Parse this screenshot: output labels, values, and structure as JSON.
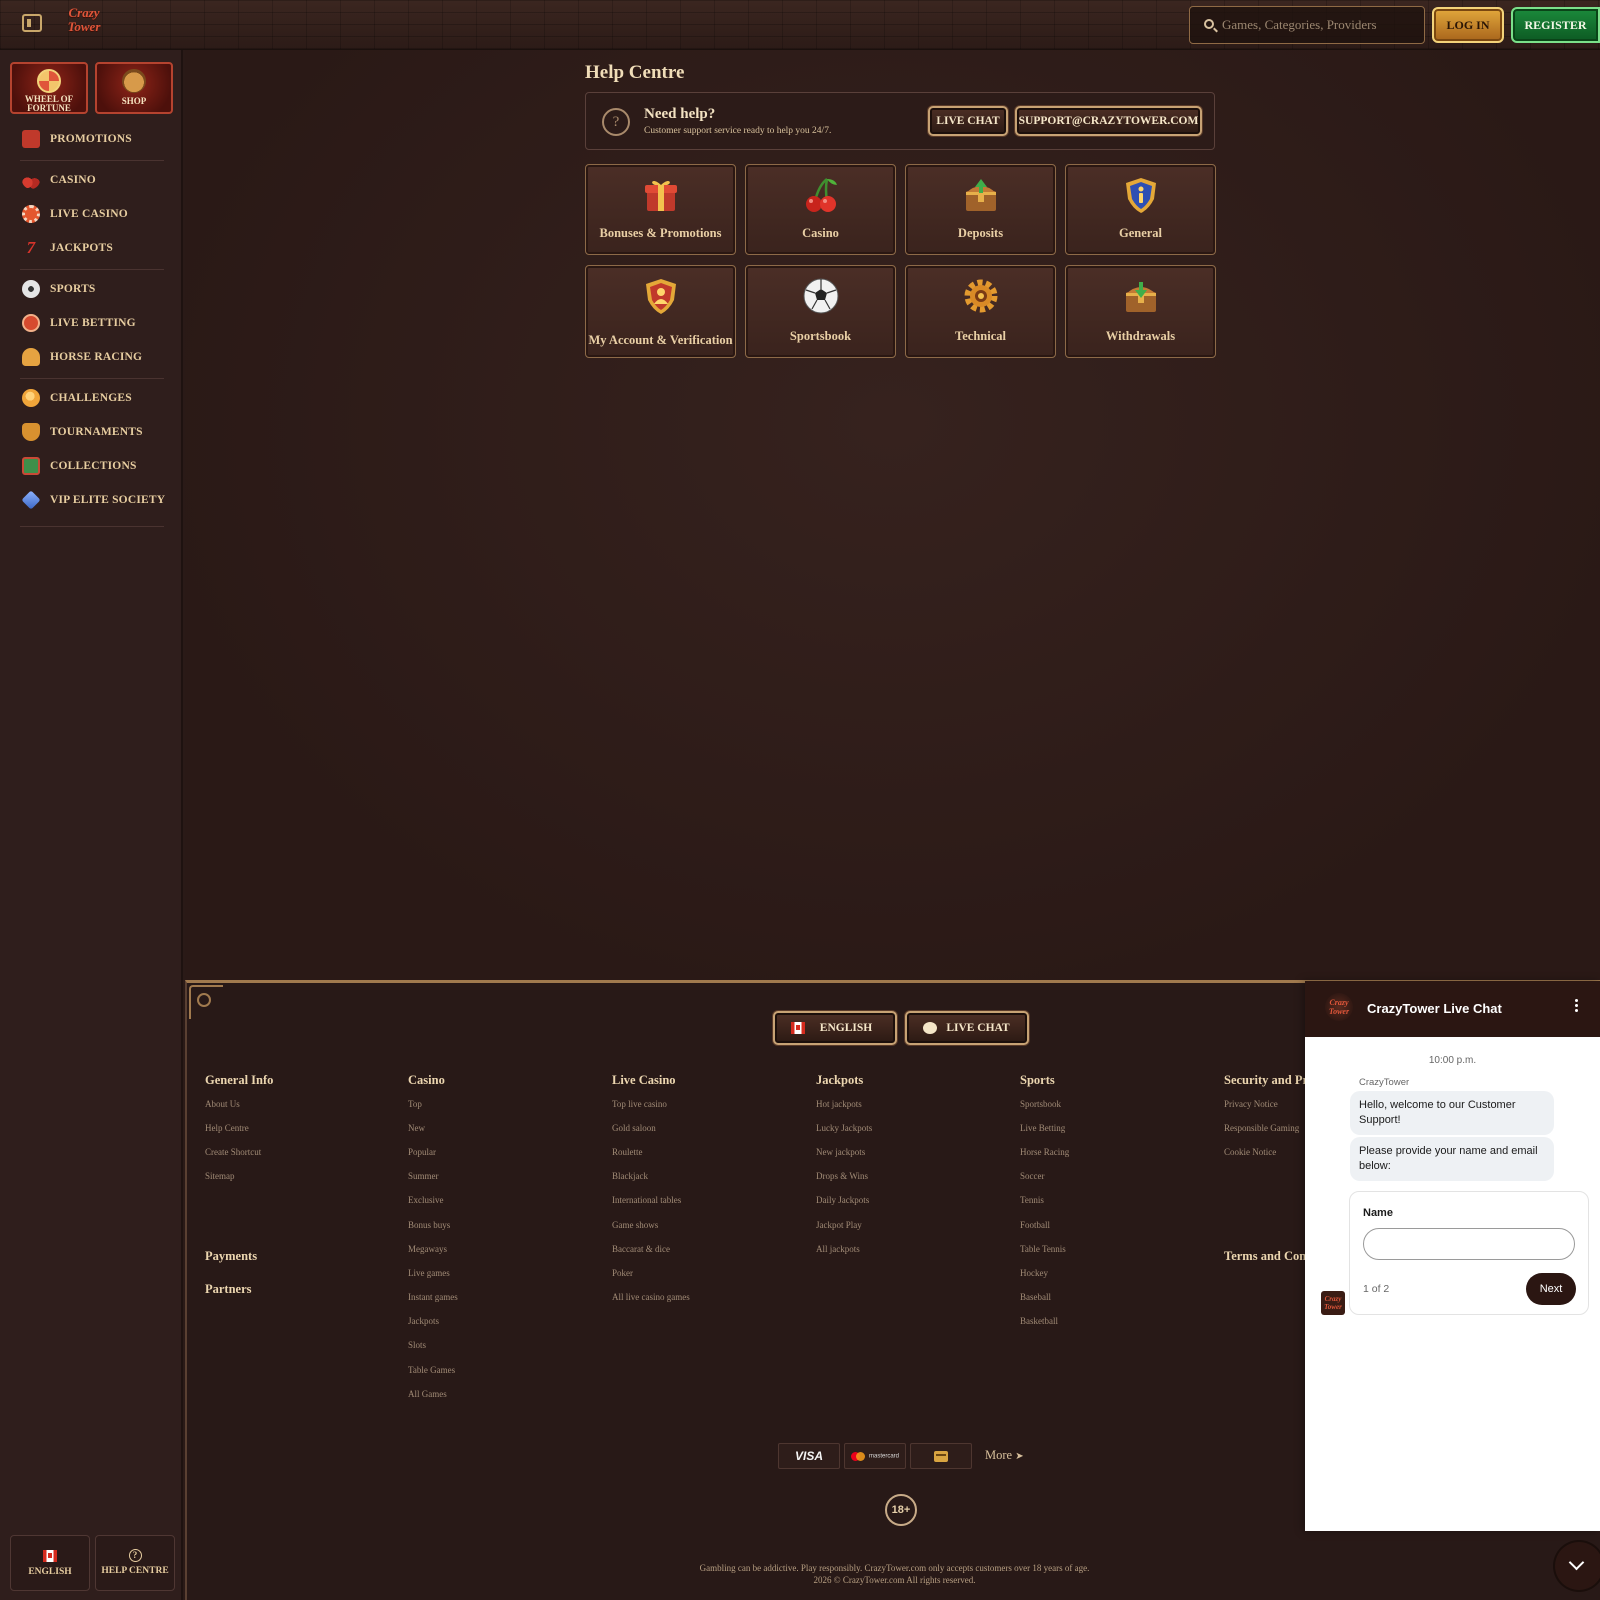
{
  "header": {
    "logo_text": "Crazy Tower",
    "search_placeholder": "Games, Categories, Providers",
    "login_label": "LOG IN",
    "register_label": "REGISTER"
  },
  "sidebar": {
    "tiles": [
      {
        "label": "WHEEL OF FORTUNE",
        "icon": "wheel-icon"
      },
      {
        "label": "SHOP",
        "icon": "basket-icon"
      }
    ],
    "items": [
      {
        "label": "PROMOTIONS",
        "icon": "gift-icon",
        "color": "#c0392b"
      },
      {
        "label": "CASINO",
        "icon": "cherry-icon",
        "color": "#d63b2f"
      },
      {
        "label": "LIVE CASINO",
        "icon": "chip-icon",
        "color": "#e4572e"
      },
      {
        "label": "JACKPOTS",
        "icon": "seven-icon",
        "color": "#d9342b"
      },
      {
        "label": "SPORTS",
        "icon": "soccer-ball-icon",
        "color": "#dddddd"
      },
      {
        "label": "LIVE BETTING",
        "icon": "live-icon",
        "color": "#d64a2f"
      },
      {
        "label": "HORSE RACING",
        "icon": "horse-icon",
        "color": "#e6a341"
      },
      {
        "label": "CHALLENGES",
        "icon": "medal-icon",
        "color": "#f0a53a"
      },
      {
        "label": "TOURNAMENTS",
        "icon": "trophy-icon",
        "color": "#d8912f"
      },
      {
        "label": "COLLECTIONS",
        "icon": "cards-icon",
        "color": "#3f8f4a"
      },
      {
        "label": "VIP ELITE SOCIETY",
        "icon": "diamond-icon",
        "color": "#4a7fd6"
      }
    ],
    "language_label": "ENGLISH",
    "help_label": "HELP CENTRE"
  },
  "main": {
    "title": "Help Centre",
    "help_banner": {
      "title": "Need help?",
      "subtitle": "Customer support service ready to help you 24/7.",
      "live_chat_label": "LIVE CHAT",
      "email_label": "SUPPORT@CRAZYTOWER.COM"
    },
    "categories": [
      {
        "label": "Bonuses & Promotions",
        "icon": "gift-icon"
      },
      {
        "label": "Casino",
        "icon": "cherry-icon"
      },
      {
        "label": "Deposits",
        "icon": "chest-icon"
      },
      {
        "label": "General",
        "icon": "info-shield-icon"
      },
      {
        "label": "My Account & Verification",
        "icon": "account-shield-icon"
      },
      {
        "label": "Sportsbook",
        "icon": "soccer-ball-icon"
      },
      {
        "label": "Technical",
        "icon": "gear-icon"
      },
      {
        "label": "Withdrawals",
        "icon": "chest-icon"
      }
    ]
  },
  "footer": {
    "language_label": "ENGLISH",
    "live_chat_label": "LIVE CHAT",
    "columns": [
      {
        "title": "General Info",
        "links": [
          "About Us",
          "Help Centre",
          "Create Shortcut",
          "Sitemap"
        ]
      },
      {
        "title": "Casino",
        "links": [
          "Top",
          "New",
          "Popular",
          "Summer",
          "Exclusive",
          "Bonus buys",
          "Megaways",
          "Live games",
          "Instant games",
          "Jackpots",
          "Slots",
          "Table Games",
          "All Games"
        ]
      },
      {
        "title": "Live Casino",
        "links": [
          "Top live casino",
          "Gold saloon",
          "Roulette",
          "Blackjack",
          "International tables",
          "Game shows",
          "Baccarat & dice",
          "Poker",
          "All live casino games"
        ]
      },
      {
        "title": "Jackpots",
        "links": [
          "Hot jackpots",
          "Lucky Jackpots",
          "New jackpots",
          "Drops & Wins",
          "Daily Jackpots",
          "Jackpot Play",
          "All jackpots"
        ]
      },
      {
        "title": "Sports",
        "links": [
          "Sportsbook",
          "Live Betting",
          "Horse Racing",
          "Soccer",
          "Tennis",
          "Football",
          "Table Tennis",
          "Hockey",
          "Baseball",
          "Basketball"
        ]
      },
      {
        "title": "Security and Pri",
        "links": [
          "Privacy Notice",
          "Responsible Gaming",
          "Cookie Notice"
        ]
      }
    ],
    "payments_title": "Payments",
    "partners_title": "Partners",
    "terms_title": "Terms and Cond",
    "payment_methods": {
      "visa": "VISA",
      "mastercard": "mastercard"
    },
    "more_label": "More",
    "age_label": "18+",
    "disclaimer": "Gambling can be addictive. Play responsibly. CrazyTower.com only accepts customers over 18 years of age.",
    "copyright": "2026 © CrazyTower.com All rights reserved."
  },
  "chat": {
    "title": "CrazyTower Live Chat",
    "time": "10:00 p.m.",
    "sender": "CrazyTower",
    "messages": [
      "Hello, welcome to our Customer Support!",
      "Please provide your name and email below:"
    ],
    "form": {
      "name_label": "Name",
      "name_value": "",
      "step": "1 of 2",
      "next_label": "Next"
    }
  }
}
